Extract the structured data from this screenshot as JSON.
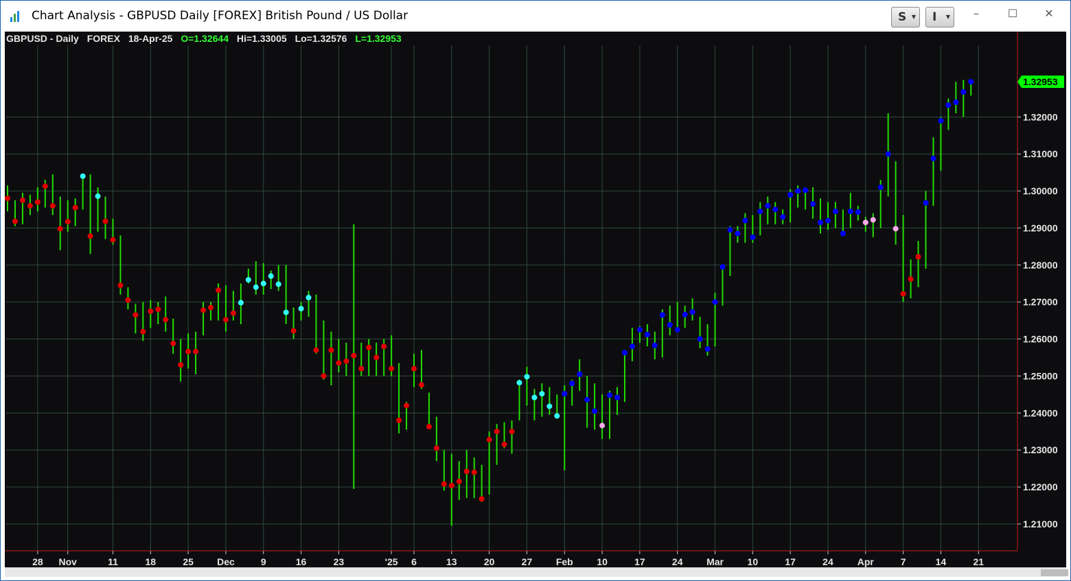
{
  "window": {
    "title": "Chart Analysis - GBPUSD Daily [FOREX] British Pound / US Dollar",
    "buttons": {
      "s_label": "S",
      "i_label": "I"
    },
    "controls": {
      "minimize": "–",
      "maximize": "☐",
      "close": "✕"
    }
  },
  "header": {
    "symbol": "GBPUSD - Daily",
    "exchange": "FOREX",
    "date": "18-Apr-25",
    "open": "O=1.32644",
    "high": "Hi=1.33005",
    "low": "Lo=1.32576",
    "last": "L=1.32953"
  },
  "chart_data": {
    "type": "bar",
    "style": "OHLC bars with colored close markers",
    "symbol": "GBPUSD",
    "interval": "Daily",
    "last_price_label": "1.32953",
    "ylim": [
      1.203,
      1.336
    ],
    "y_ticks": [
      1.21,
      1.22,
      1.23,
      1.24,
      1.25,
      1.26,
      1.27,
      1.28,
      1.29,
      1.3,
      1.31,
      1.32
    ],
    "y_tick_labels": [
      "1.21000",
      "1.22000",
      "1.23000",
      "1.24000",
      "1.25000",
      "1.26000",
      "1.27000",
      "1.28000",
      "1.29000",
      "1.30000",
      "1.31000",
      "1.32000"
    ],
    "x_ticks": [
      {
        "label": "28",
        "i": 4
      },
      {
        "label": "Nov",
        "i": 8
      },
      {
        "label": "11",
        "i": 14
      },
      {
        "label": "18",
        "i": 19
      },
      {
        "label": "25",
        "i": 24
      },
      {
        "label": "Dec",
        "i": 29
      },
      {
        "label": "9",
        "i": 34
      },
      {
        "label": "16",
        "i": 39
      },
      {
        "label": "23",
        "i": 44
      },
      {
        "label": "'25",
        "i": 51
      },
      {
        "label": "6",
        "i": 54
      },
      {
        "label": "13",
        "i": 59
      },
      {
        "label": "20",
        "i": 64
      },
      {
        "label": "27",
        "i": 69
      },
      {
        "label": "Feb",
        "i": 74
      },
      {
        "label": "10",
        "i": 79
      },
      {
        "label": "17",
        "i": 84
      },
      {
        "label": "24",
        "i": 89
      },
      {
        "label": "Mar",
        "i": 94
      },
      {
        "label": "10",
        "i": 99
      },
      {
        "label": "17",
        "i": 104
      },
      {
        "label": "24",
        "i": 109
      },
      {
        "label": "Apr",
        "i": 114
      },
      {
        "label": "7",
        "i": 119
      },
      {
        "label": "14",
        "i": 124
      },
      {
        "label": "21",
        "i": 129
      }
    ],
    "marker_colors": {
      "r": "#e00000",
      "c": "#33ffff",
      "b": "#0000ff",
      "p": "#ffaaee"
    },
    "bar_color": "#22dd00",
    "grid": true,
    "bars": [
      [
        1.3015,
        1.2945,
        1.298,
        "r"
      ],
      [
        1.2975,
        1.2905,
        1.2918,
        "r"
      ],
      [
        1.2995,
        1.291,
        1.2975,
        "r"
      ],
      [
        1.299,
        1.2935,
        1.296,
        "r"
      ],
      [
        1.301,
        1.2945,
        1.297,
        "r"
      ],
      [
        1.303,
        1.2955,
        1.3013,
        "r"
      ],
      [
        1.3045,
        1.2935,
        1.296,
        "r"
      ],
      [
        1.2985,
        1.284,
        1.2898,
        "r"
      ],
      [
        1.2975,
        1.289,
        1.2917,
        "r"
      ],
      [
        1.298,
        1.2905,
        1.2955,
        "r"
      ],
      [
        1.304,
        1.295,
        1.304,
        "c"
      ],
      [
        1.3045,
        1.283,
        1.2878,
        "r"
      ],
      [
        1.301,
        1.289,
        1.2986,
        "c"
      ],
      [
        1.2985,
        1.287,
        1.2918,
        "r"
      ],
      [
        1.2925,
        1.2855,
        1.2868,
        "r"
      ],
      [
        1.288,
        1.272,
        1.2745,
        "r"
      ],
      [
        1.274,
        1.268,
        1.2705,
        "r"
      ],
      [
        1.2695,
        1.2615,
        1.2665,
        "r"
      ],
      [
        1.27,
        1.2595,
        1.262,
        "r"
      ],
      [
        1.2705,
        1.263,
        1.2675,
        "r"
      ],
      [
        1.27,
        1.264,
        1.268,
        "r"
      ],
      [
        1.2715,
        1.262,
        1.2652,
        "r"
      ],
      [
        1.2655,
        1.256,
        1.2588,
        "r"
      ],
      [
        1.26,
        1.2485,
        1.253,
        "r"
      ],
      [
        1.2615,
        1.252,
        1.2566,
        "r"
      ],
      [
        1.262,
        1.2505,
        1.2566,
        "r"
      ],
      [
        1.27,
        1.261,
        1.2678,
        "r"
      ],
      [
        1.27,
        1.265,
        1.2685,
        "r"
      ],
      [
        1.275,
        1.265,
        1.2732,
        "r"
      ],
      [
        1.2745,
        1.262,
        1.2652,
        "r"
      ],
      [
        1.273,
        1.265,
        1.267,
        "r"
      ],
      [
        1.275,
        1.264,
        1.2698,
        "c"
      ],
      [
        1.279,
        1.275,
        1.276,
        "c"
      ],
      [
        1.281,
        1.272,
        1.274,
        "c"
      ],
      [
        1.2805,
        1.272,
        1.275,
        "c"
      ],
      [
        1.2785,
        1.2735,
        1.277,
        "c"
      ],
      [
        1.28,
        1.273,
        1.2748,
        "c"
      ],
      [
        1.28,
        1.264,
        1.2672,
        "c"
      ],
      [
        1.2685,
        1.26,
        1.2622,
        "r"
      ],
      [
        1.27,
        1.265,
        1.2682,
        "c"
      ],
      [
        1.273,
        1.266,
        1.2712,
        "c"
      ],
      [
        1.272,
        1.256,
        1.257,
        "r"
      ],
      [
        1.265,
        1.249,
        1.25,
        "r"
      ],
      [
        1.262,
        1.2475,
        1.257,
        "r"
      ],
      [
        1.26,
        1.251,
        1.2535,
        "r"
      ],
      [
        1.259,
        1.25,
        1.254,
        "r"
      ],
      [
        1.291,
        1.2195,
        1.2555,
        "r"
      ],
      [
        1.259,
        1.25,
        1.252,
        "r"
      ],
      [
        1.26,
        1.25,
        1.2577,
        "r"
      ],
      [
        1.259,
        1.25,
        1.255,
        "r"
      ],
      [
        1.26,
        1.25,
        1.258,
        "r"
      ],
      [
        1.261,
        1.25,
        1.252,
        "r"
      ],
      [
        1.2535,
        1.2345,
        1.238,
        "r"
      ],
      [
        1.243,
        1.2355,
        1.242,
        "r"
      ],
      [
        1.256,
        1.247,
        1.252,
        "r"
      ],
      [
        1.257,
        1.2465,
        1.2476,
        "r"
      ],
      [
        1.2455,
        1.236,
        1.2363,
        "r"
      ],
      [
        1.239,
        1.227,
        1.2305,
        "r"
      ],
      [
        1.23,
        1.219,
        1.2208,
        "r"
      ],
      [
        1.229,
        1.2095,
        1.2204,
        "r"
      ],
      [
        1.227,
        1.2165,
        1.2215,
        "r"
      ],
      [
        1.23,
        1.217,
        1.2242,
        "r"
      ],
      [
        1.228,
        1.217,
        1.224,
        "r"
      ],
      [
        1.226,
        1.216,
        1.2168,
        "r"
      ],
      [
        1.235,
        1.218,
        1.2328,
        "r"
      ],
      [
        1.237,
        1.226,
        1.235,
        "r"
      ],
      [
        1.2375,
        1.2305,
        1.2315,
        "r"
      ],
      [
        1.238,
        1.229,
        1.235,
        "r"
      ],
      [
        1.249,
        1.238,
        1.2482,
        "c"
      ],
      [
        1.2525,
        1.242,
        1.2498,
        "c"
      ],
      [
        1.2465,
        1.238,
        1.2442,
        "c"
      ],
      [
        1.248,
        1.239,
        1.2452,
        "c"
      ],
      [
        1.247,
        1.2395,
        1.2418,
        "c"
      ],
      [
        1.245,
        1.239,
        1.2392,
        "c"
      ],
      [
        1.2475,
        1.2245,
        1.2452,
        "b"
      ],
      [
        1.249,
        1.242,
        1.248,
        "b"
      ],
      [
        1.2545,
        1.246,
        1.2505,
        "b"
      ],
      [
        1.25,
        1.236,
        1.2436,
        "b"
      ],
      [
        1.248,
        1.2355,
        1.2405,
        "b"
      ],
      [
        1.245,
        1.233,
        1.2366,
        "p"
      ],
      [
        1.246,
        1.233,
        1.2448,
        "b"
      ],
      [
        1.247,
        1.2395,
        1.2442,
        "b"
      ],
      [
        1.2565,
        1.243,
        1.2563,
        "b"
      ],
      [
        1.263,
        1.254,
        1.258,
        "b"
      ],
      [
        1.2635,
        1.259,
        1.2625,
        "b"
      ],
      [
        1.264,
        1.258,
        1.2612,
        "b"
      ],
      [
        1.262,
        1.2545,
        1.2583,
        "b"
      ],
      [
        1.268,
        1.255,
        1.2665,
        "b"
      ],
      [
        1.269,
        1.261,
        1.2638,
        "b"
      ],
      [
        1.27,
        1.262,
        1.2625,
        "b"
      ],
      [
        1.269,
        1.263,
        1.2666,
        "b"
      ],
      [
        1.271,
        1.265,
        1.2673,
        "b"
      ],
      [
        1.266,
        1.2575,
        1.26,
        "b"
      ],
      [
        1.264,
        1.2555,
        1.2573,
        "b"
      ],
      [
        1.2725,
        1.258,
        1.27,
        "b"
      ],
      [
        1.28,
        1.269,
        1.2795,
        "b"
      ],
      [
        1.2905,
        1.277,
        1.2895,
        "b"
      ],
      [
        1.2905,
        1.286,
        1.2885,
        "b"
      ],
      [
        1.294,
        1.286,
        1.292,
        "b"
      ],
      [
        1.2935,
        1.286,
        1.2875,
        "b"
      ],
      [
        1.297,
        1.288,
        1.2945,
        "b"
      ],
      [
        1.2985,
        1.291,
        1.296,
        "b"
      ],
      [
        1.297,
        1.291,
        1.295,
        "b"
      ],
      [
        1.295,
        1.291,
        1.293,
        "b"
      ],
      [
        1.3005,
        1.2915,
        1.299,
        "b"
      ],
      [
        1.3015,
        1.2955,
        1.3,
        "b"
      ],
      [
        1.301,
        1.295,
        1.3002,
        "b"
      ],
      [
        1.301,
        1.2925,
        1.2965,
        "b"
      ],
      [
        1.298,
        1.2885,
        1.2915,
        "b"
      ],
      [
        1.297,
        1.2895,
        1.292,
        "b"
      ],
      [
        1.297,
        1.29,
        1.2945,
        "b"
      ],
      [
        1.295,
        1.288,
        1.2885,
        "b"
      ],
      [
        1.2995,
        1.29,
        1.2945,
        "b"
      ],
      [
        1.296,
        1.292,
        1.2943,
        "b"
      ],
      [
        1.293,
        1.289,
        1.2915,
        "p"
      ],
      [
        1.294,
        1.2875,
        1.2922,
        "p"
      ],
      [
        1.303,
        1.29,
        1.301,
        "b"
      ],
      [
        1.321,
        1.2985,
        1.31,
        "b"
      ],
      [
        1.308,
        1.2855,
        1.2898,
        "p"
      ],
      [
        1.2935,
        1.27,
        1.2722,
        "r"
      ],
      [
        1.2815,
        1.271,
        1.2762,
        "r"
      ],
      [
        1.2865,
        1.274,
        1.2822,
        "r"
      ],
      [
        1.3,
        1.279,
        1.2968,
        "b"
      ],
      [
        1.3145,
        1.296,
        1.3088,
        "b"
      ],
      [
        1.32,
        1.3055,
        1.319,
        "b"
      ],
      [
        1.325,
        1.3165,
        1.3232,
        "b"
      ],
      [
        1.3295,
        1.321,
        1.324,
        "b"
      ],
      [
        1.33,
        1.32,
        1.3268,
        "b"
      ],
      [
        1.33005,
        1.32576,
        1.32953,
        "b"
      ]
    ]
  }
}
